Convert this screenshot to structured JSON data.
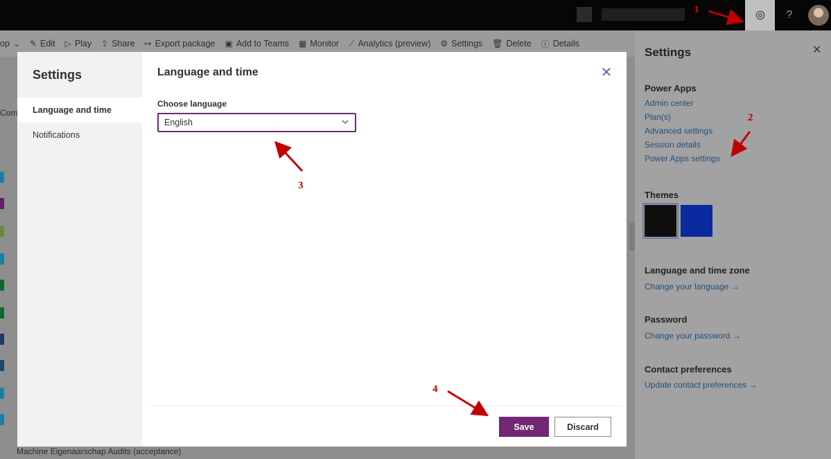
{
  "topbar": {
    "help_label": "?"
  },
  "commandbar": {
    "items": [
      {
        "label": "op",
        "icon": "chevron-down-icon"
      },
      {
        "label": "Edit",
        "icon": "pencil-icon"
      },
      {
        "label": "Play",
        "icon": "play-icon"
      },
      {
        "label": "Share",
        "icon": "share-icon"
      },
      {
        "label": "Export package",
        "icon": "export-icon"
      },
      {
        "label": "Add to Teams",
        "icon": "teams-icon"
      },
      {
        "label": "Monitor",
        "icon": "monitor-icon"
      },
      {
        "label": "Analytics (preview)",
        "icon": "analytics-icon"
      },
      {
        "label": "Settings",
        "icon": "gear-icon"
      },
      {
        "label": "Delete",
        "icon": "trash-icon"
      },
      {
        "label": "Details",
        "icon": "info-icon"
      }
    ]
  },
  "background_list": {
    "fragment": "Com",
    "last_row_text": "Machine Eigenaarschap Audits (acceptance)"
  },
  "right_panel": {
    "title": "Settings",
    "power_apps": {
      "heading": "Power Apps",
      "links": [
        "Admin center",
        "Plan(s)",
        "Advanced settings",
        "Session details",
        "Power Apps settings"
      ]
    },
    "themes": {
      "heading": "Themes",
      "colors": [
        "#0e0e0e",
        "#0a2aa0"
      ]
    },
    "language": {
      "heading": "Language and time zone",
      "link": "Change your language →"
    },
    "password": {
      "heading": "Password",
      "link": "Change your password →"
    },
    "contact": {
      "heading": "Contact preferences",
      "link": "Update contact preferences →"
    }
  },
  "modal": {
    "nav_title": "Settings",
    "nav_items": [
      {
        "label": "Language and time",
        "active": true
      },
      {
        "label": "Notifications",
        "active": false
      }
    ],
    "content_title": "Language and time",
    "field_label": "Choose language",
    "selected_language": "English",
    "save_label": "Save",
    "discard_label": "Discard"
  },
  "annotations": [
    "1",
    "2",
    "3",
    "4"
  ],
  "colors": {
    "accent": "#742774",
    "annotation": "#c00000"
  }
}
